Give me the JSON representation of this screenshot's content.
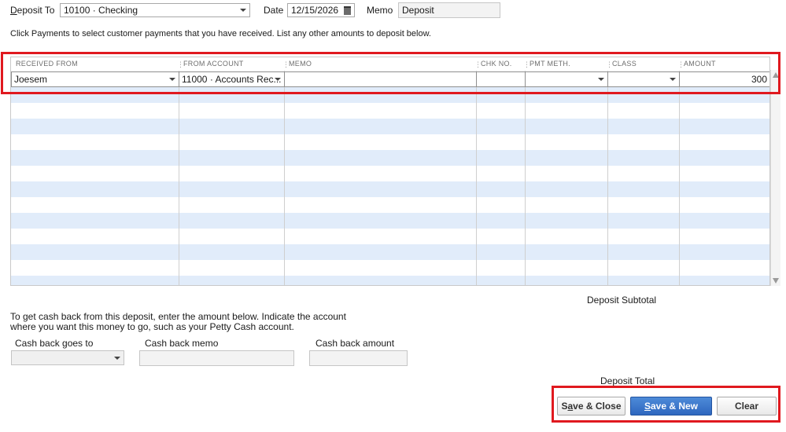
{
  "header": {
    "deposit_to_label": "Deposit To",
    "deposit_to_value": "10100 · Checking",
    "date_label": "Date",
    "date_value": "12/15/2026",
    "memo_label": "Memo",
    "memo_value": "Deposit"
  },
  "instructions": "Click Payments to select customer payments that you have received. List any other amounts to deposit below.",
  "grid": {
    "columns": [
      "RECEIVED FROM",
      "FROM ACCOUNT",
      "MEMO",
      "CHK NO.",
      "PMT METH.",
      "CLASS",
      "AMOUNT"
    ],
    "rows": [
      {
        "received_from": "Joesem",
        "from_account": "11000 · Accounts Rec...",
        "memo": "",
        "chk_no": "",
        "pmt_meth": "",
        "class": "",
        "amount": "300"
      }
    ]
  },
  "subtotal_label": "Deposit Subtotal",
  "cashback": {
    "instruction_line1": "To get cash back from this deposit, enter the amount below.  Indicate the account",
    "instruction_line2": "where you want this money to go, such as your Petty Cash account.",
    "goes_to_label": "Cash back goes to",
    "memo_label": "Cash back memo",
    "amount_label": "Cash back amount"
  },
  "total_label": "Deposit Total",
  "buttons": {
    "save_close_a": "S",
    "save_close_u": "a",
    "save_close_b": "ve & Close",
    "save_new_u": "S",
    "save_new_b": "ave & New",
    "clear": "Clear"
  },
  "colors": {
    "highlight": "#e0191f",
    "row_alt": "#e1ecfa",
    "primary_button": "#2e67bf"
  }
}
